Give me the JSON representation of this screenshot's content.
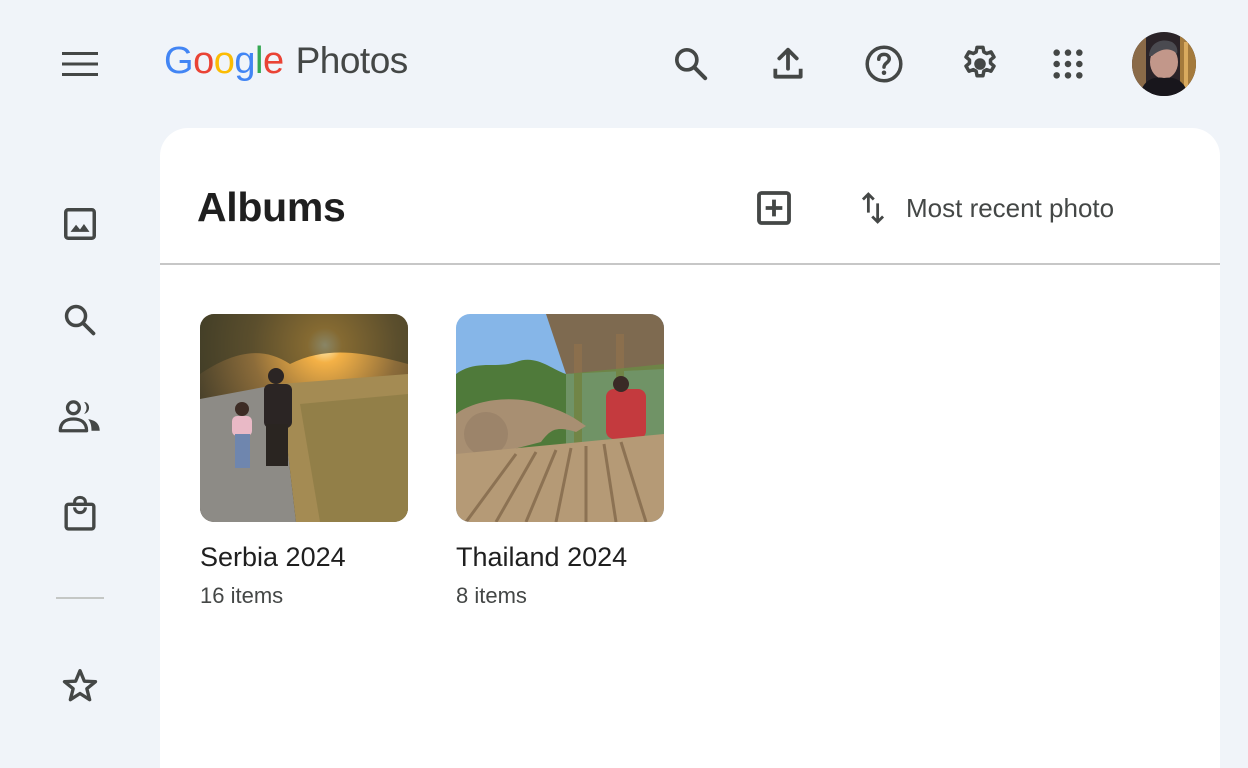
{
  "header": {
    "logo_google": [
      "G",
      "o",
      "o",
      "g",
      "l",
      "e"
    ],
    "logo_google_colors": [
      "#4285f4",
      "#ea4335",
      "#fbbc04",
      "#4285f4",
      "#34a853",
      "#ea4335"
    ],
    "product_name": "Photos",
    "icons": [
      "menu-icon",
      "search-icon",
      "upload-icon",
      "help-icon",
      "settings-icon",
      "apps-icon",
      "avatar"
    ]
  },
  "sidebar": {
    "items": [
      {
        "name": "photos",
        "icon": "photo-icon"
      },
      {
        "name": "search",
        "icon": "search-icon"
      },
      {
        "name": "sharing",
        "icon": "people-icon"
      },
      {
        "name": "print-store",
        "icon": "shopping-bag-icon"
      },
      {
        "name": "favorites",
        "icon": "star-icon"
      }
    ]
  },
  "main": {
    "title": "Albums",
    "create_album_icon": "add-box-icon",
    "sort_label": "Most recent photo",
    "albums": [
      {
        "name": "Serbia 2024",
        "count": "16 items"
      },
      {
        "name": "Thailand 2024",
        "count": "8 items"
      }
    ]
  },
  "colors": {
    "background": "#f0f4f9",
    "icon": "#444746",
    "text": "#1f1f1f"
  }
}
